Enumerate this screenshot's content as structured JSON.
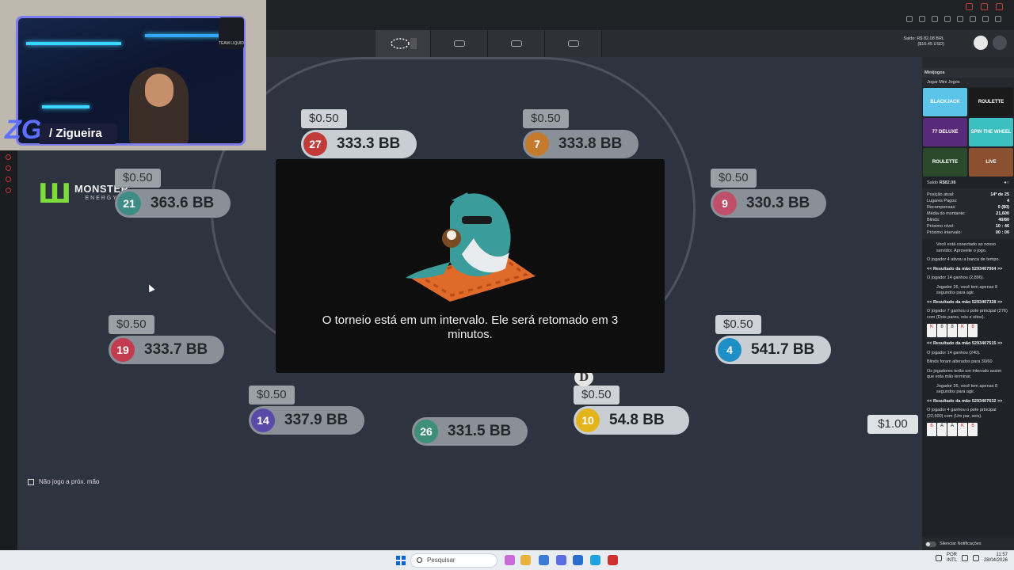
{
  "header": {
    "balance_label": "Saldo: R$ 82,08 BRL",
    "balance_usd": "($16.45 USD)"
  },
  "webcam": {
    "streamer_name": "/ Zigueira",
    "logo_text": "ZG",
    "badge_text": "TEAM LIQUID"
  },
  "sponsor": {
    "brand": "MONSTER",
    "sub": "ENERGY"
  },
  "seats": [
    {
      "num": "27",
      "bet": "$0.50",
      "stack": "333.3 BB",
      "color": "#c23b3b",
      "dim": false
    },
    {
      "num": "7",
      "bet": "$0.50",
      "stack": "333.8 BB",
      "color": "#c47a2c",
      "dim": true
    },
    {
      "num": "21",
      "bet": "$0.50",
      "stack": "363.6 BB",
      "color": "#3f8c86",
      "dim": true
    },
    {
      "num": "9",
      "bet": "$0.50",
      "stack": "330.3 BB",
      "color": "#c0506a",
      "dim": true
    },
    {
      "num": "19",
      "bet": "$0.50",
      "stack": "333.7 BB",
      "color": "#c23b4e",
      "dim": true
    },
    {
      "num": "4",
      "bet": "$0.50",
      "stack": "541.7 BB",
      "color": "#1f8fc7",
      "dim": false
    },
    {
      "num": "14",
      "bet": "$0.50",
      "stack": "337.9 BB",
      "color": "#5a4aa8",
      "dim": true
    },
    {
      "num": "26",
      "bet": "",
      "stack": "331.5 BB",
      "color": "#3e8e7a",
      "dim": true
    },
    {
      "num": "10",
      "bet": "$0.50",
      "stack": "54.8 BB",
      "color": "#e3b51b",
      "dim": false
    }
  ],
  "dealer_button": "D",
  "side_pot": "$1.00",
  "modal": {
    "message": "O torneio está em um intervalo. Ele será retomado em 3 minutos."
  },
  "sitout_label": "Não jogo a próx. mão",
  "panel": {
    "title": "Minijogos",
    "subtitle": "Jogar Mini Jogos",
    "games": [
      "BLACKJACK",
      "ROULETTE",
      "77 DELUXE",
      "SPIN THE WHEEL",
      "ROULETTE",
      "LIVE"
    ],
    "saldo_label": "Saldo",
    "saldo_value": "R$82.08",
    "stats": [
      {
        "label": "Posição atual:",
        "value": "14º de 25"
      },
      {
        "label": "Lugares Pagos:",
        "value": "4"
      },
      {
        "label": "Recompensas:",
        "value": "0 ($0)"
      },
      {
        "label": "Média do montante:",
        "value": "21,600"
      },
      {
        "label": "Blinds:",
        "value": "40/80"
      },
      {
        "label": "Próximo nível:",
        "value": "10 : 46"
      },
      {
        "label": "Próximo intervalo:",
        "value": "00 : 00"
      }
    ],
    "chat": {
      "m1": "Você está conectado ao nosso servidor. Aproveite o jogo.",
      "m2": "O jogador 4 ativou a banca de tempo.",
      "h1": "<< Resultado da mão 5293407064 >>",
      "m3": "O jogador 14 ganhou (2,896).",
      "m4": "Jogador 26, você tem apenas 8 segundos para agir.",
      "h2": "<< Resultado da mão 5293407328 >>",
      "m5": "O jogador 7 ganhou o pote principal (276) com (Dois pares, reis e oitos).",
      "h3": "<< Resultado da mão 5293407515 >>",
      "m6": "O jogador 14 ganhou (240).",
      "m7": "Blinds foram alterados para 30/60",
      "m8": "Os jogadores terão um intervalo assim que esta mão terminar.",
      "m9": "Jogador 26, você tem apenas 8 segundos para agir.",
      "h4": "<< Resultado da mão 5293407632 >>",
      "m10": "O jogador 4 ganhou o pote principal (22,500) com (Um par, seis)."
    },
    "cards1": [
      "K",
      "8",
      "8",
      "K",
      "8"
    ],
    "cards2": [
      "6",
      "A",
      "A",
      "K",
      "6"
    ],
    "mute_label": "Silenciar Notificações"
  },
  "taskbar": {
    "search_placeholder": "Pesquisar",
    "lang": "POR",
    "lang2": "INTL",
    "time": "11:57",
    "date": "28/04/2026"
  }
}
